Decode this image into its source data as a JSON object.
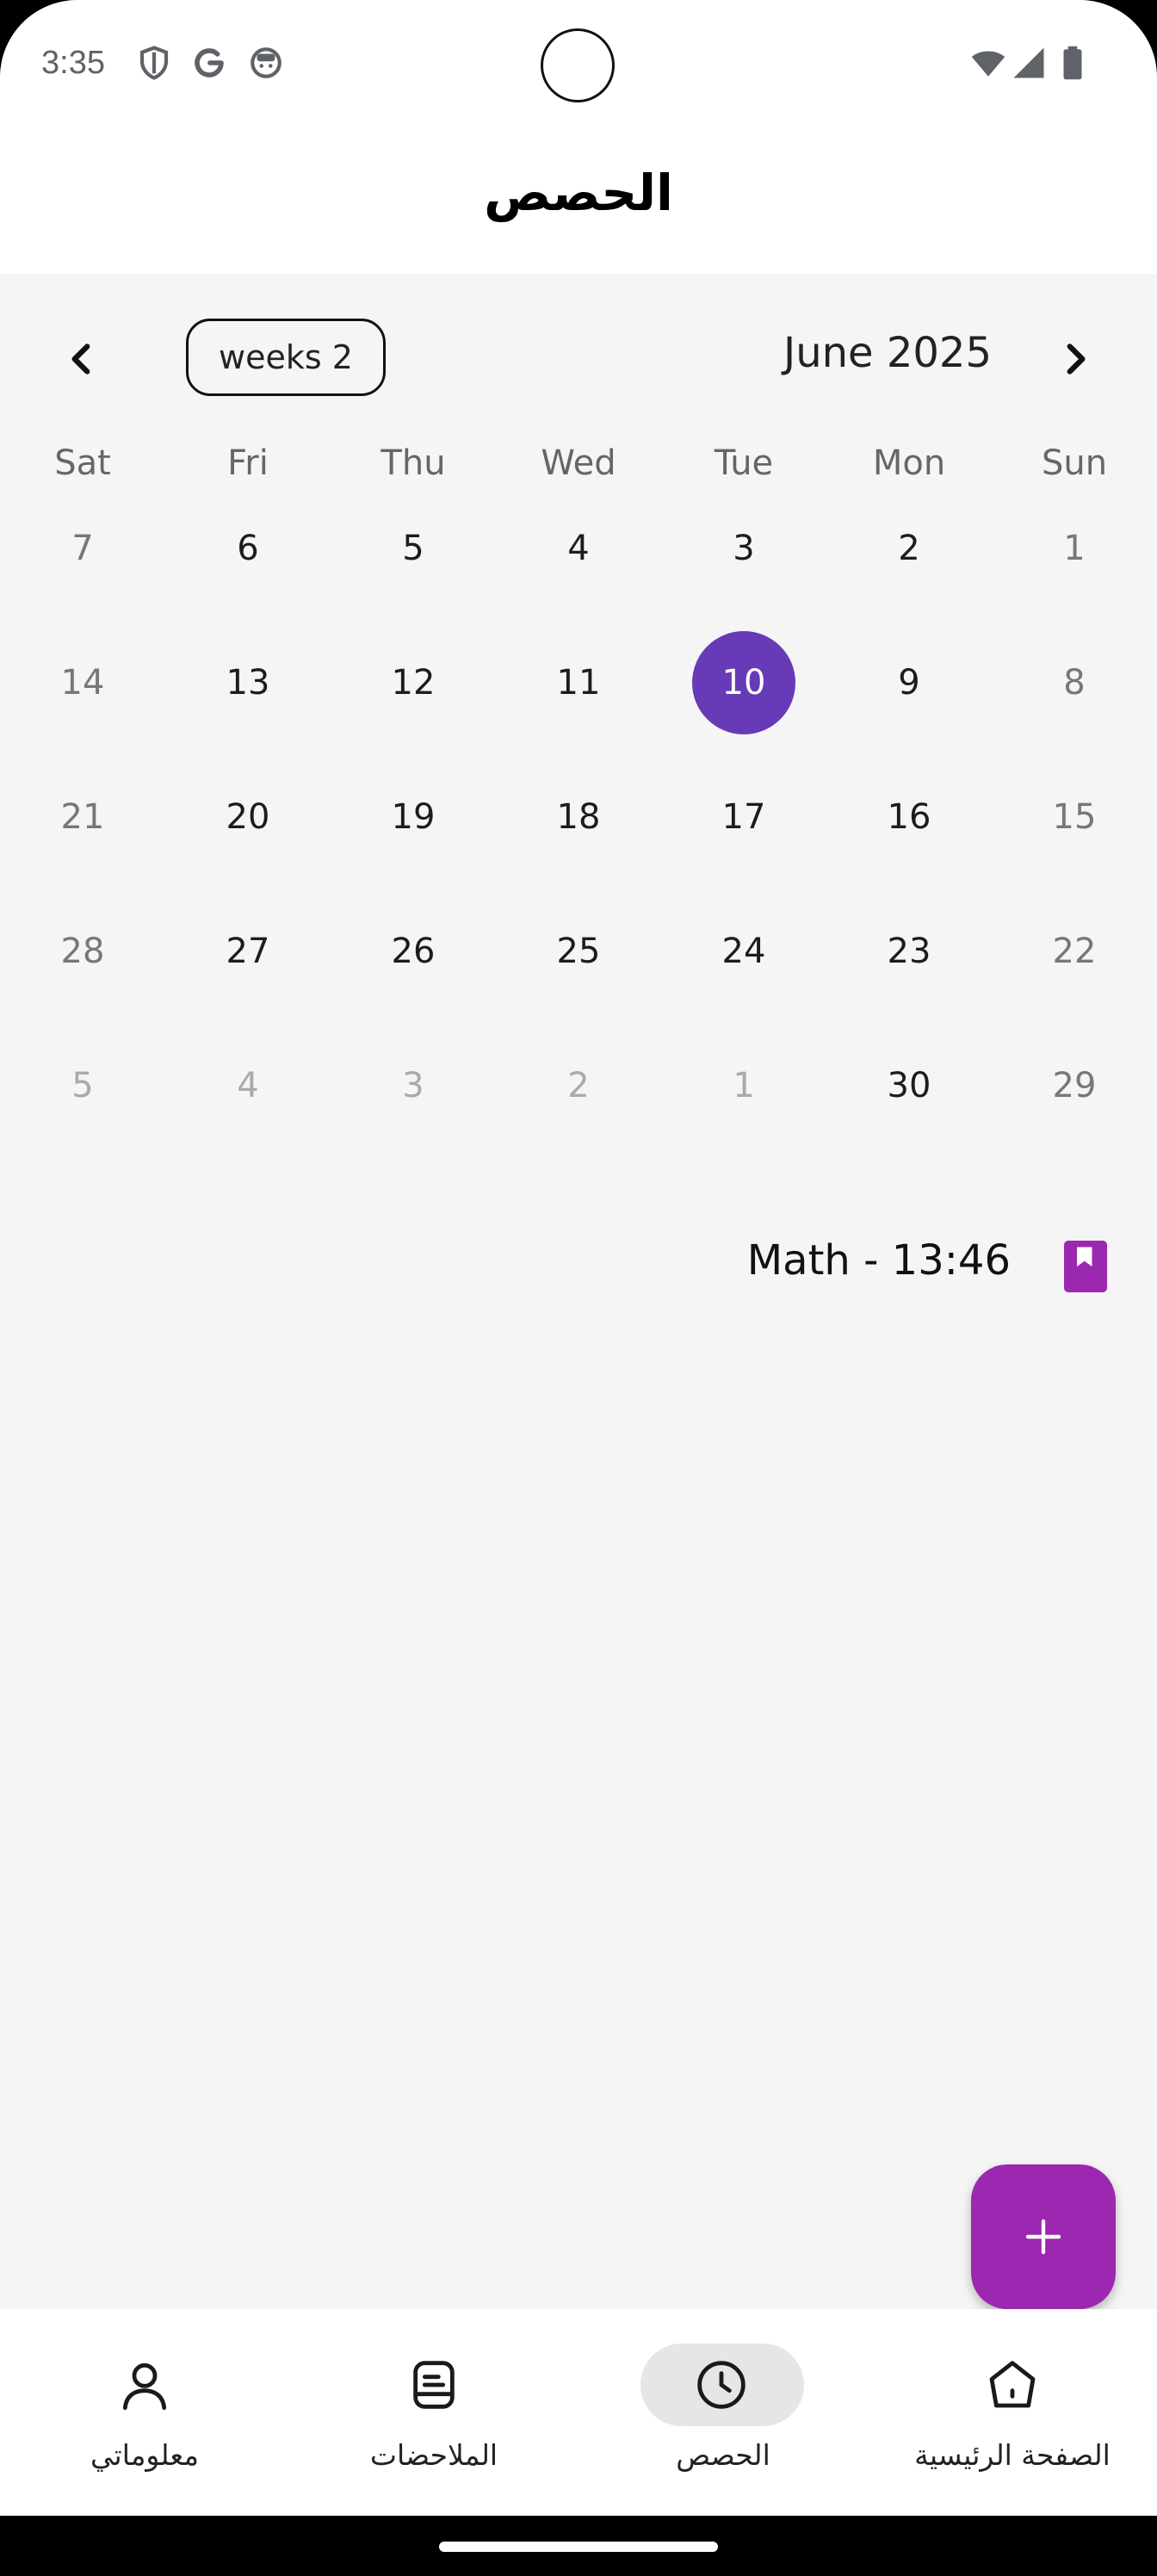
{
  "status_bar": {
    "time": "3:35",
    "left_icons": [
      "shield-icon",
      "google-icon",
      "face-icon"
    ],
    "right_icons": [
      "wifi-icon",
      "cell-signal-icon",
      "battery-icon"
    ]
  },
  "app_bar": {
    "title": "الحصص"
  },
  "calendar": {
    "format_button": "weeks 2",
    "month_title": "June 2025",
    "prev_icon": "chevron-left-icon",
    "next_icon": "chevron-right-icon",
    "weekdays": [
      "Sun",
      "Mon",
      "Tue",
      "Wed",
      "Thu",
      "Fri",
      "Sat"
    ],
    "weeks": [
      [
        "1",
        "2",
        "3",
        "4",
        "5",
        "6",
        "7"
      ],
      [
        "8",
        "9",
        "10",
        "11",
        "12",
        "13",
        "14"
      ],
      [
        "15",
        "16",
        "17",
        "18",
        "19",
        "20",
        "21"
      ],
      [
        "22",
        "23",
        "24",
        "25",
        "26",
        "27",
        "28"
      ],
      [
        "29",
        "30",
        "1",
        "2",
        "3",
        "4",
        "5"
      ]
    ],
    "selected_day": "10",
    "accent_color": "#673ab7"
  },
  "lessons": [
    {
      "label": "Math - 13:46",
      "icon": "bookmark-book-icon",
      "icon_color": "#9c27b0"
    }
  ],
  "fab": {
    "icon": "plus-icon",
    "color": "#9c27b0"
  },
  "bottom_nav": {
    "items": [
      {
        "label": "الصفحة الرئيسية",
        "icon": "home-icon",
        "active": false
      },
      {
        "label": "الحصص",
        "icon": "clock-icon",
        "active": true
      },
      {
        "label": "الملاحضات",
        "icon": "notes-icon",
        "active": false
      },
      {
        "label": "معلوماتي",
        "icon": "person-icon",
        "active": false
      }
    ]
  }
}
